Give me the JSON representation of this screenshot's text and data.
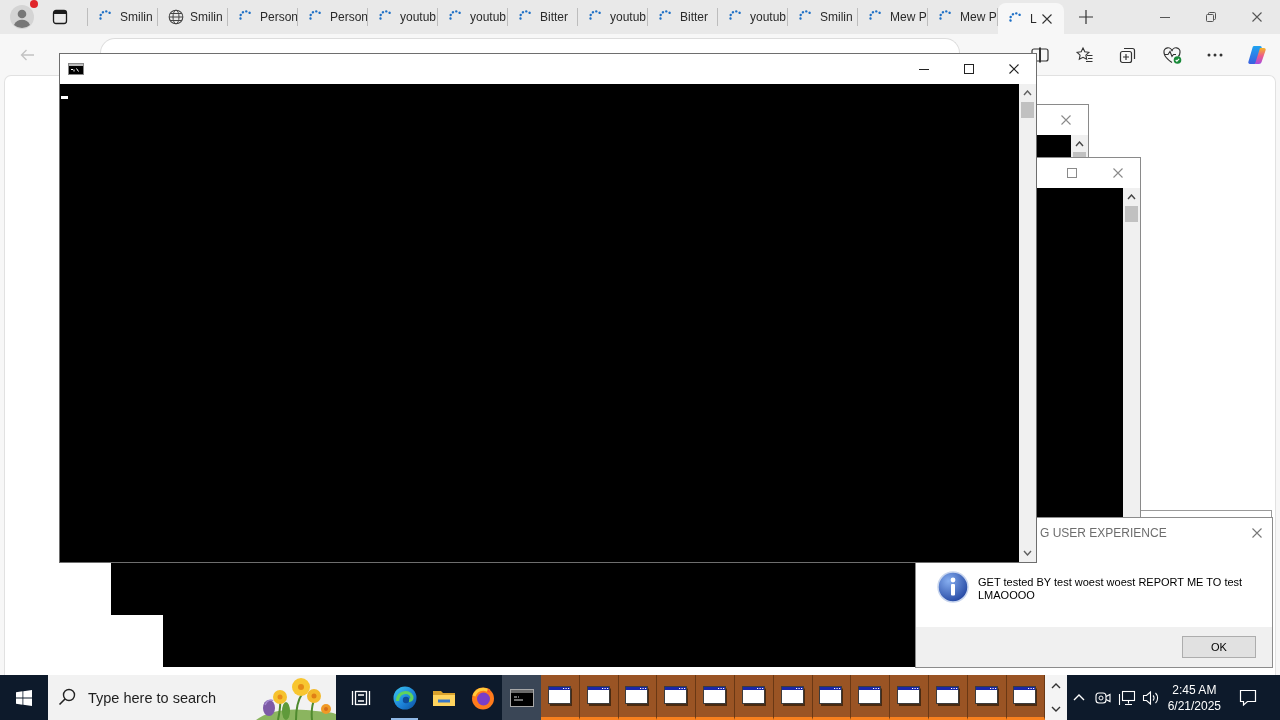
{
  "browser": {
    "profile": {
      "notification": true
    },
    "tabs": [
      {
        "title": "Smilin",
        "kind": "loading",
        "selected": false
      },
      {
        "title": "Smilin",
        "kind": "globe",
        "selected": false
      },
      {
        "title": "Person",
        "kind": "loading",
        "selected": false
      },
      {
        "title": "Person",
        "kind": "loading",
        "selected": false
      },
      {
        "title": "youtub",
        "kind": "loading",
        "selected": false
      },
      {
        "title": "youtub",
        "kind": "loading",
        "selected": false
      },
      {
        "title": "Bitter",
        "kind": "loading",
        "selected": false
      },
      {
        "title": "youtub",
        "kind": "loading",
        "selected": false
      },
      {
        "title": "Bitter",
        "kind": "loading",
        "selected": false
      },
      {
        "title": "youtub",
        "kind": "loading",
        "selected": false
      },
      {
        "title": "Smilin",
        "kind": "loading",
        "selected": false
      },
      {
        "title": "Mew P",
        "kind": "loading",
        "selected": false
      },
      {
        "title": "Mew P",
        "kind": "loading",
        "selected": false
      },
      {
        "title": "L",
        "kind": "loading",
        "selected": true
      }
    ],
    "back_button": {
      "disabled": true
    }
  },
  "message_box": {
    "title": "G USER EXPERIENCE",
    "message": "GET tested BY test woest woest REPORT ME TO test LMAOOOO",
    "buttons": [
      "OK"
    ]
  },
  "taskbar": {
    "search": {
      "placeholder": "Type here to search"
    },
    "apps": [
      {
        "kind": "task_view",
        "running": false,
        "selected": false
      },
      {
        "kind": "edge",
        "running": true,
        "selected": false
      },
      {
        "kind": "file_explorer",
        "running": false,
        "selected": false
      },
      {
        "kind": "firefox",
        "running": false,
        "selected": false
      },
      {
        "kind": "terminal",
        "running": false,
        "selected": true
      }
    ],
    "window_buttons": [
      {
        "flashing": true
      },
      {
        "flashing": true
      },
      {
        "flashing": true
      },
      {
        "flashing": true
      },
      {
        "flashing": true
      },
      {
        "flashing": true
      },
      {
        "flashing": true
      },
      {
        "flashing": true
      },
      {
        "flashing": true
      },
      {
        "flashing": true
      },
      {
        "flashing": true
      },
      {
        "flashing": true
      },
      {
        "flashing": true
      }
    ],
    "clock": {
      "time": "2:45 AM",
      "date": "6/21/2025"
    }
  }
}
